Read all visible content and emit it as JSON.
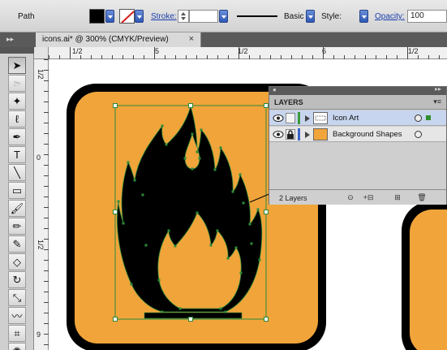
{
  "control_bar": {
    "object_type": "Path",
    "stroke_label": "Stroke:",
    "brush_label": "Basic",
    "style_label": "Style:",
    "opacity_label": "Opacity:",
    "opacity_value": "100"
  },
  "document_tab": {
    "title": "icons.ai* @ 300% (CMYK/Preview)",
    "close_glyph": "×"
  },
  "rulers": {
    "top_labels": [
      "1/2",
      "5",
      "1/2",
      "6",
      "1/2"
    ],
    "left_labels": [
      "1/2",
      "0",
      "1/2",
      "9"
    ]
  },
  "layers_panel": {
    "title": "LAYERS",
    "layers": [
      {
        "name": "Icon Art",
        "color": "#3d9a3d",
        "selected": true
      },
      {
        "name": "Background Shapes",
        "color": "#3b63c8",
        "selected": false
      }
    ],
    "count_label": "2 Layers"
  },
  "colors": {
    "orange": "#f0a43a",
    "fill_swatch": "#000000",
    "selection": "#2d8a3a",
    "accent": "#1b3fae"
  },
  "tools": [
    "selection-icon",
    "direct-selection-icon",
    "magic-wand-icon",
    "lasso-icon",
    "pen-icon",
    "type-icon",
    "line-segment-icon",
    "rectangle-icon",
    "paintbrush-icon",
    "pencil-icon",
    "blob-brush-icon",
    "eraser-icon",
    "rotate-icon",
    "scale-icon",
    "warp-icon",
    "free-transform-icon",
    "symbol-sprayer-icon"
  ]
}
